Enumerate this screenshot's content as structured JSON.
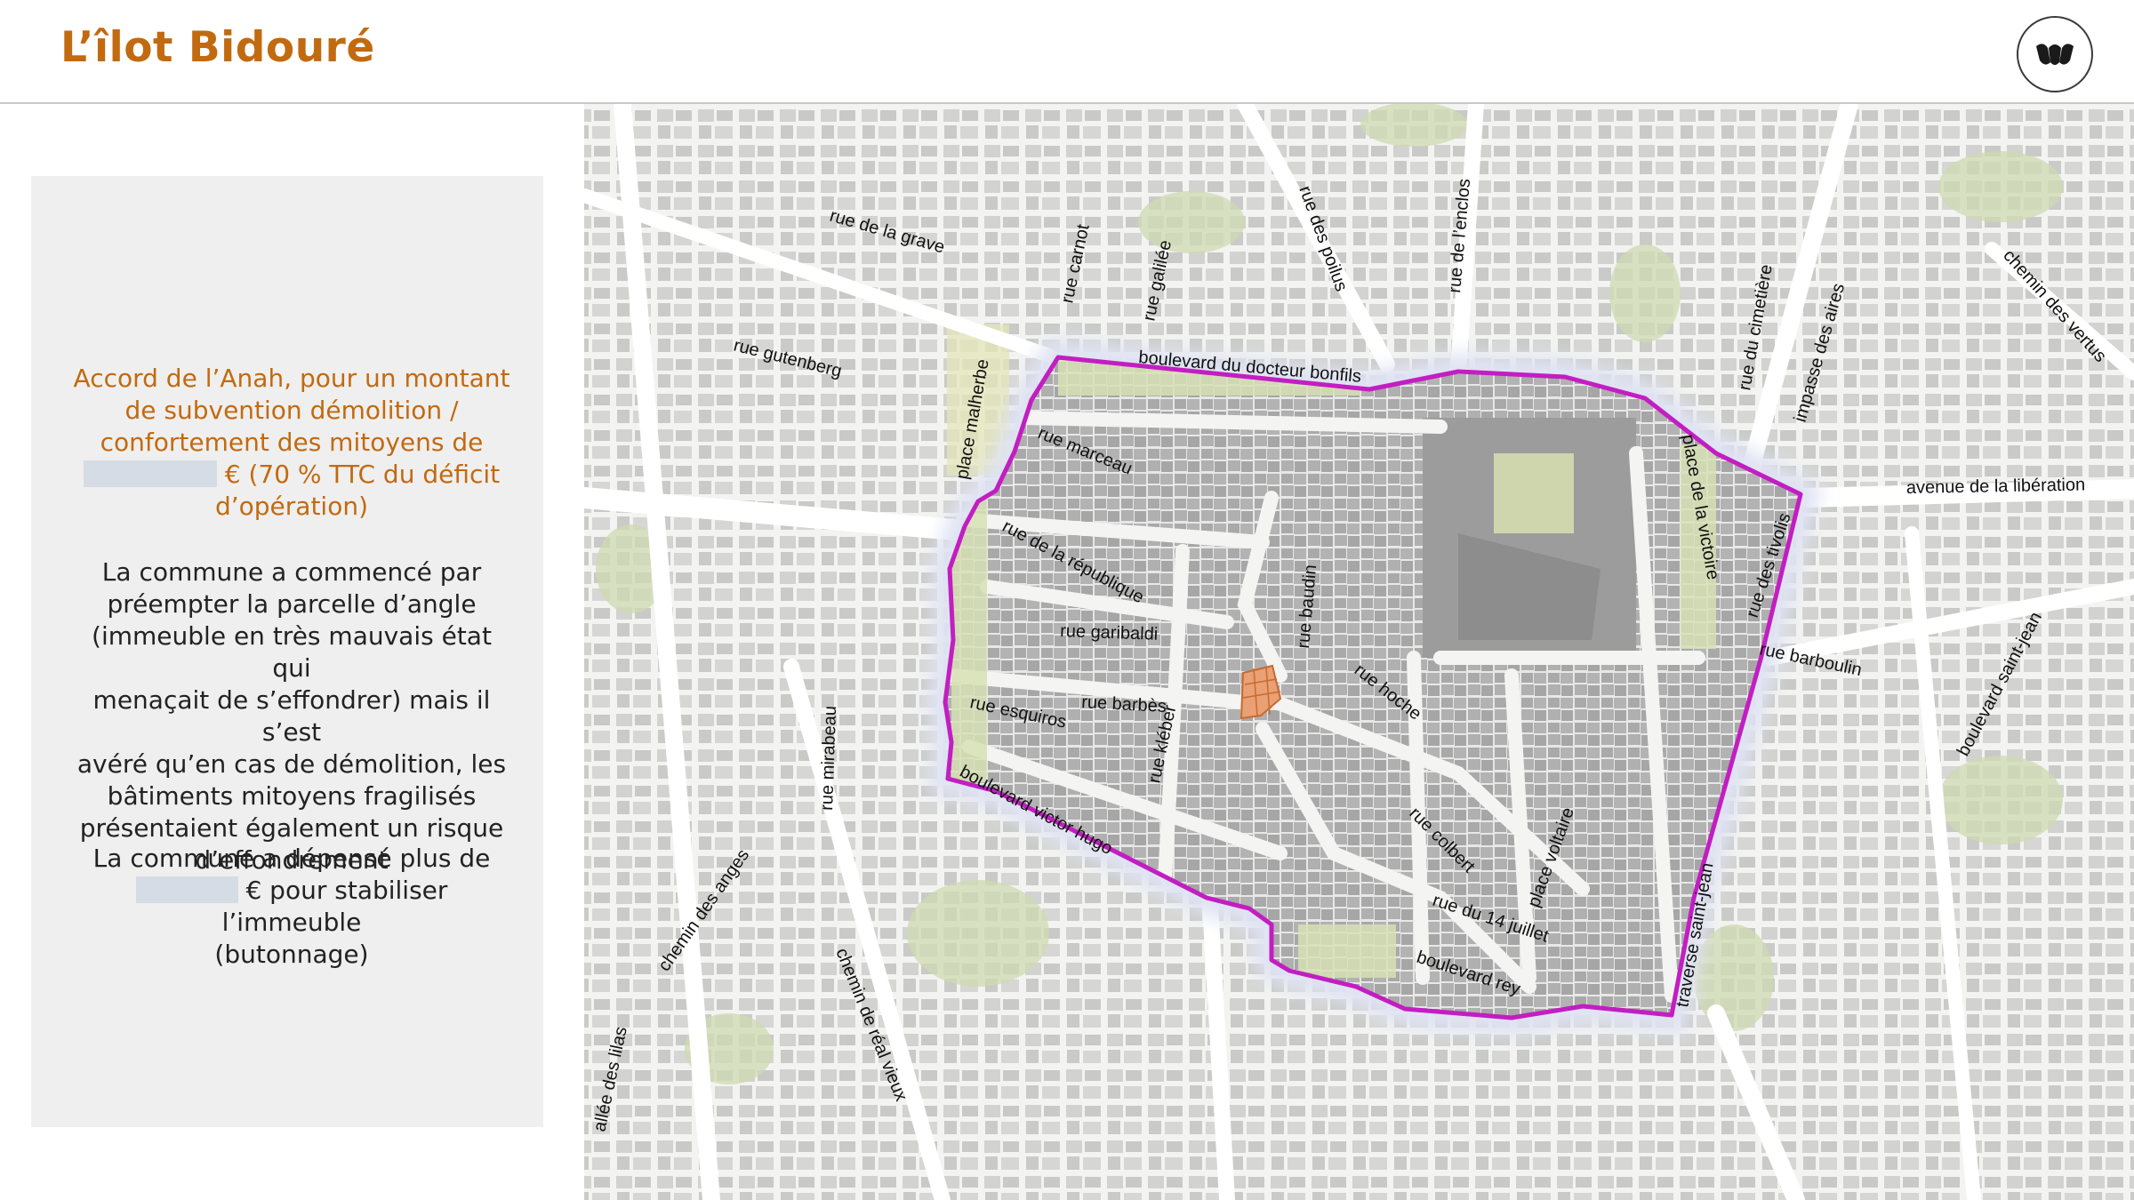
{
  "header": {
    "title": "L’îlot Bidouré",
    "logo_icon": "monogram-logo-icon"
  },
  "info_panel": {
    "anah": {
      "line1": "Accord de l’Anah, pour un montant",
      "line2": "de subvention démolition /",
      "line3": "confortement des mitoyens de",
      "line4_suffix": "€ (70 % TTC du déficit",
      "line5": "d’opération)"
    },
    "commune": {
      "line1": "La commune a commencé par",
      "line2": "préempter la parcelle d’angle",
      "line3": "(immeuble en très mauvais état qui",
      "line4": "menaçait de s’effondrer) mais il s’est",
      "line5": "avéré qu’en cas de démolition, les",
      "line6": "bâtiments mitoyens fragilisés",
      "line7": "présentaient également un risque",
      "line8": "d’effondrement"
    },
    "depense": {
      "line1": "La commune a dépensé plus de",
      "line2_suffix": "€ pour stabiliser l’immeuble",
      "line3": "(butonnage)"
    }
  },
  "map": {
    "perimeter_color": "#c21ec2",
    "parcel_color": "#e0894a",
    "streets": {
      "grave": "rue de la grave",
      "carnot": "rue carnot",
      "galilee": "rue galilée",
      "poilus": "rue des poilus",
      "enclos": "rue de l’enclos",
      "gutenberg": "rue gutenberg",
      "bonfils": "boulevard du docteur bonfils",
      "malherbe": "place malherbe",
      "marceau": "rue marceau",
      "republique": "rue de la république",
      "garibaldi": "rue garibaldi",
      "barbes": "rue barbès",
      "esquiros": "rue esquiros",
      "kleber": "rue kléber",
      "baudin": "rue baudin",
      "hoche": "rue hoche",
      "colbert": "rue colbert",
      "voltaire": "place voltaire",
      "quatorze": "rue du 14 juillet",
      "rey": "boulevard rey",
      "victor_hugo": "boulevard victor hugo",
      "mirabeau": "rue mirabeau",
      "anges": "chemin des anges",
      "real_vieux": "chemin de réal vieux",
      "lilas": "allée des lilas",
      "cimetiere": "rue du cimetière",
      "aires": "impasse des aires",
      "vertus": "chemin des vertus",
      "liberation": "avenue de la libération",
      "victoire": "place de la victoire",
      "tivolis": "rue des tivolis",
      "barboulin": "rue barboulin",
      "saint_jean_bd": "boulevard saint-jean",
      "saint_jean_tr": "traverse saint-jean"
    }
  }
}
